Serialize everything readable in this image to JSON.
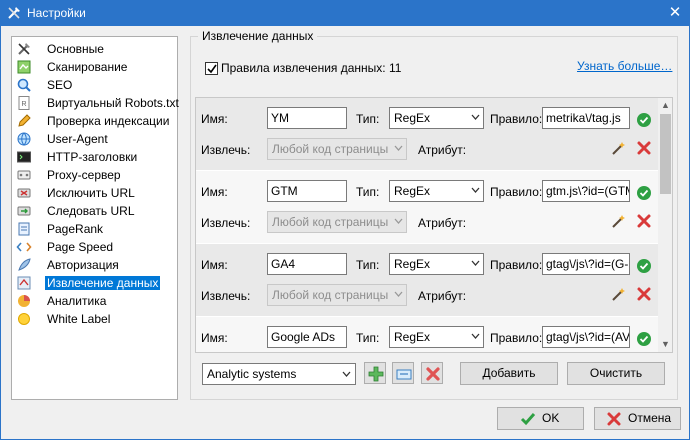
{
  "window": {
    "title": "Настройки",
    "close_glyph": "✕",
    "icon": "tools-icon"
  },
  "nav": {
    "items": [
      {
        "label": "Основные",
        "icon": "tools-icon"
      },
      {
        "label": "Сканирование",
        "icon": "scan-icon"
      },
      {
        "label": "SEO",
        "icon": "seo-search-icon"
      },
      {
        "label": "Виртуальный Robots.txt",
        "icon": "robots-file-icon"
      },
      {
        "label": "Проверка индексации",
        "icon": "pencil-icon"
      },
      {
        "label": "User-Agent",
        "icon": "globe-icon"
      },
      {
        "label": "HTTP-заголовки",
        "icon": "terminal-icon"
      },
      {
        "label": "Proxy-сервер",
        "icon": "proxy-icon"
      },
      {
        "label": "Исключить URL",
        "icon": "exclude-url-icon"
      },
      {
        "label": "Следовать URL",
        "icon": "follow-url-icon"
      },
      {
        "label": "PageRank",
        "icon": "pagerank-icon"
      },
      {
        "label": "Page Speed",
        "icon": "code-icon"
      },
      {
        "label": "Авторизация",
        "icon": "feather-icon"
      },
      {
        "label": "Извлечение данных",
        "icon": "extract-icon"
      },
      {
        "label": "Аналитика",
        "icon": "pie-chart-icon"
      },
      {
        "label": "White Label",
        "icon": "sun-icon"
      }
    ],
    "active_index": 13
  },
  "panel": {
    "group_title": "Извлечение данных",
    "checkbox_label": "Правила извлечения данных: 11",
    "checkbox_checked": true,
    "learn_more": "Узнать больше…"
  },
  "labels": {
    "name": "Имя:",
    "type": "Тип:",
    "rule": "Правило:",
    "extract": "Извлечь:",
    "attribute": "Атрибут:"
  },
  "rules": [
    {
      "name": "YM",
      "type": "RegEx",
      "rule": "metrika\\/tag.js",
      "extract": "Любой код страницы",
      "attribute": ""
    },
    {
      "name": "GTM",
      "type": "RegEx",
      "rule": "gtm.js\\?id=(GTM",
      "extract": "Любой код страницы",
      "attribute": ""
    },
    {
      "name": "GA4",
      "type": "RegEx",
      "rule": "gtag\\/js\\?id=(G-",
      "extract": "Любой код страницы",
      "attribute": ""
    },
    {
      "name": "Google ADs",
      "type": "RegEx",
      "rule": "gtag\\/js\\?id=(AV",
      "extract": "",
      "attribute": ""
    }
  ],
  "scroll": {
    "up": "▲",
    "down": "▼"
  },
  "footer": {
    "preset": "Analytic systems",
    "add": "Добавить",
    "clear": "Очистить",
    "ok": "OK",
    "cancel": "Отмена"
  },
  "colors": {
    "titlebar": "#2b74c9",
    "selection": "#0078d7",
    "link": "#0066cc",
    "ok_green": "#2ea043",
    "delete_red": "#d93a3a"
  }
}
